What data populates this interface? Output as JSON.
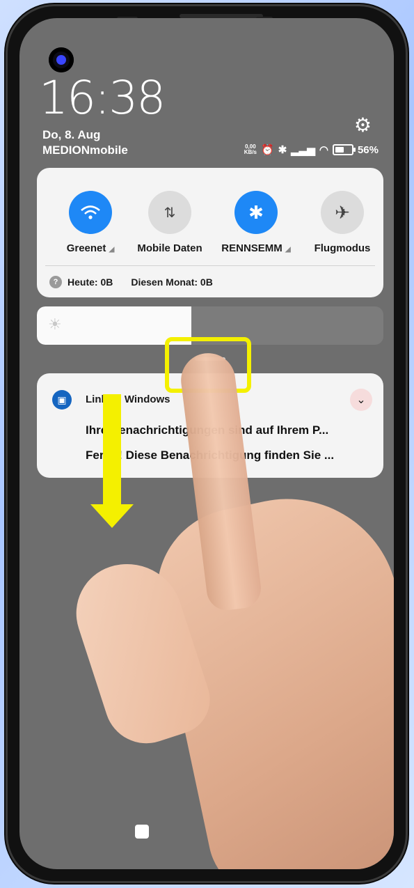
{
  "status": {
    "time": "16:38",
    "date": "Do, 8. Aug",
    "carrier": "MEDIONmobile",
    "speed_top": "0,00",
    "speed_unit": "KB/s",
    "battery": "56%"
  },
  "quick_settings": {
    "toggles": [
      {
        "label": "Greenet",
        "icon": "wifi-icon",
        "state": "on"
      },
      {
        "label": "Mobile Daten",
        "icon": "mobile-data-icon",
        "state": "off"
      },
      {
        "label": "RENNSEMM",
        "icon": "bluetooth-icon",
        "state": "on"
      },
      {
        "label": "Flugmodus",
        "icon": "airplane-icon",
        "state": "off"
      }
    ],
    "usage_today": "Heute: 0B",
    "usage_month": "Diesen Monat: 0B"
  },
  "brightness": {
    "level": 0.45
  },
  "notification": {
    "app_name": "Link zu Windows",
    "line1": "Ihre Benachrichtigungen sind auf Ihrem P...",
    "line2": "Fertig! Diese Benachrichtigung finden Sie ..."
  },
  "colors": {
    "accent": "#1e88f6",
    "highlight": "#f4f000"
  }
}
